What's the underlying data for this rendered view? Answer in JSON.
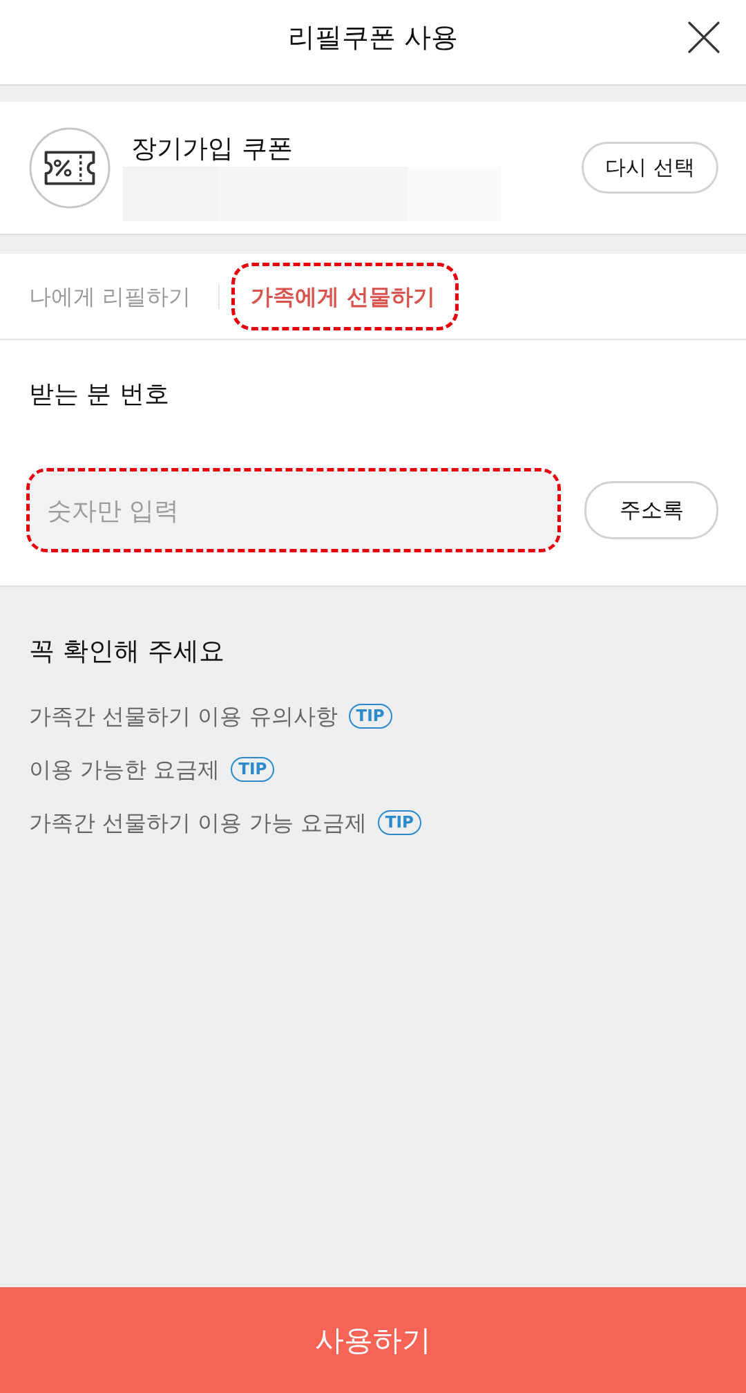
{
  "header": {
    "title": "리필쿠폰 사용"
  },
  "coupon": {
    "name": "장기가입 쿠폰",
    "reselect_button": "다시 선택"
  },
  "tabs": [
    {
      "label": "나에게 리필하기",
      "selected": false,
      "highlighted": false
    },
    {
      "label": "가족에게 선물하기",
      "selected": true,
      "highlighted": true
    }
  ],
  "recipient": {
    "label": "받는 분 번호",
    "placeholder": "숫자만 입력",
    "highlighted": true,
    "contacts_button": "주소록"
  },
  "notice": {
    "title": "꼭 확인해 주세요",
    "items": [
      {
        "text": "가족간 선물하기 이용 유의사항",
        "badge": "TIP"
      },
      {
        "text": "이용 가능한 요금제",
        "badge": "TIP"
      },
      {
        "text": "가족간 선물하기 이용 가능 요금제",
        "badge": "TIP"
      }
    ]
  },
  "submit_button": "사용하기"
}
